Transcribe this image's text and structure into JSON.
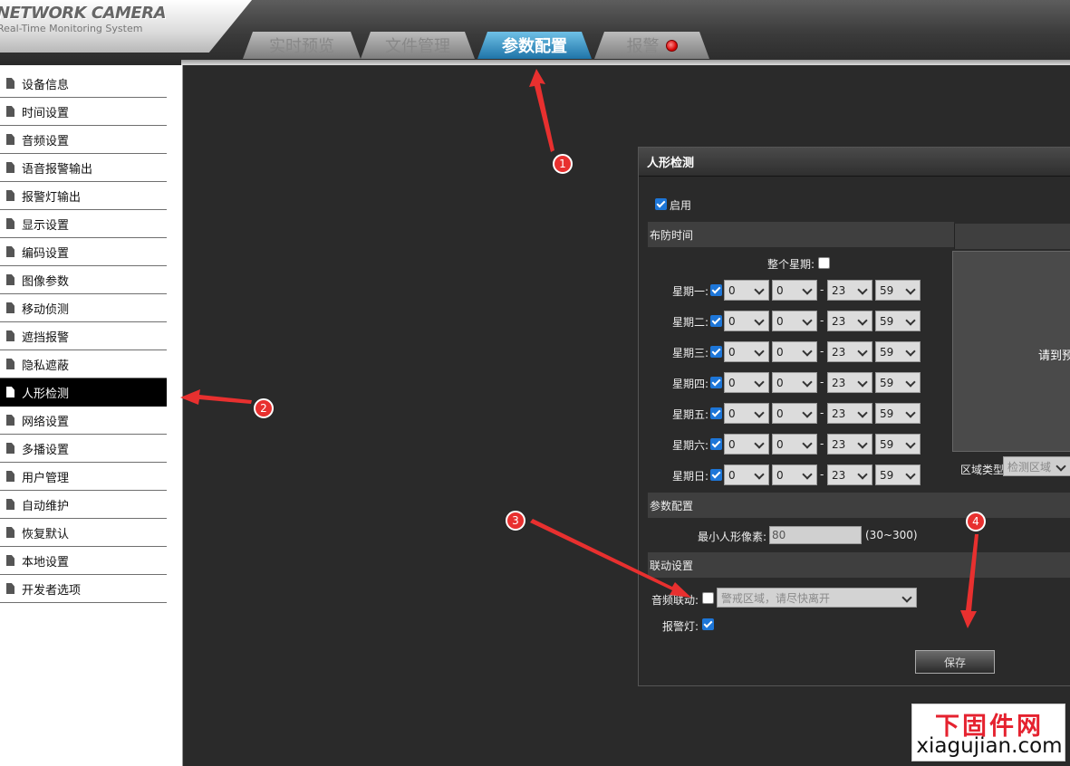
{
  "header": {
    "brand_title": "NETWORK CAMERA",
    "brand_subtitle": "Real-Time Monitoring System",
    "tabs": [
      {
        "label": "实时预览"
      },
      {
        "label": "文件管理"
      },
      {
        "label": "参数配置"
      },
      {
        "label": "报警"
      }
    ],
    "active_tab": "参数配置"
  },
  "sidebar": {
    "items": [
      {
        "label": "设备信息"
      },
      {
        "label": "时间设置"
      },
      {
        "label": "音频设置"
      },
      {
        "label": "语音报警输出"
      },
      {
        "label": "报警灯输出"
      },
      {
        "label": "显示设置"
      },
      {
        "label": "编码设置"
      },
      {
        "label": "图像参数"
      },
      {
        "label": "移动侦测"
      },
      {
        "label": "遮挡报警"
      },
      {
        "label": "隐私遮蔽"
      },
      {
        "label": "人形检测"
      },
      {
        "label": "网络设置"
      },
      {
        "label": "多播设置"
      },
      {
        "label": "用户管理"
      },
      {
        "label": "自动维护"
      },
      {
        "label": "恢复默认"
      },
      {
        "label": "本地设置"
      },
      {
        "label": "开发者选项"
      }
    ],
    "active_item": "人形检测"
  },
  "panel": {
    "title": "人形检测",
    "enable": {
      "label": "启用",
      "checked": true
    },
    "schedule": {
      "section_label": "布防时间",
      "whole_week_label": "整个星期:",
      "whole_week_checked": false,
      "days": [
        {
          "label": "星期一:",
          "checked": true,
          "start_hour": "0",
          "start_min": "0",
          "end_hour": "23",
          "end_min": "59"
        },
        {
          "label": "星期二:",
          "checked": true,
          "start_hour": "0",
          "start_min": "0",
          "end_hour": "23",
          "end_min": "59"
        },
        {
          "label": "星期三:",
          "checked": true,
          "start_hour": "0",
          "start_min": "0",
          "end_hour": "23",
          "end_min": "59"
        },
        {
          "label": "星期四:",
          "checked": true,
          "start_hour": "0",
          "start_min": "0",
          "end_hour": "23",
          "end_min": "59"
        },
        {
          "label": "星期五:",
          "checked": true,
          "start_hour": "0",
          "start_min": "0",
          "end_hour": "23",
          "end_min": "59"
        },
        {
          "label": "星期六:",
          "checked": true,
          "start_hour": "0",
          "start_min": "0",
          "end_hour": "23",
          "end_min": "59"
        },
        {
          "label": "星期日:",
          "checked": true,
          "start_hour": "0",
          "start_min": "0",
          "end_hour": "23",
          "end_min": "59"
        }
      ],
      "separator": "-"
    },
    "preview": {
      "hint": "请到预",
      "region_type_label": "区域类型",
      "region_type_value": "检测区域"
    },
    "params": {
      "section_label": "参数配置",
      "min_pixel_label": "最小人形像素:",
      "min_pixel_value": "80",
      "min_pixel_range": "(30~300)"
    },
    "linkage": {
      "section_label": "联动设置",
      "audio_label": "音频联动:",
      "audio_checked": false,
      "audio_value": "警戒区域，请尽快离开",
      "light_label": "报警灯:",
      "light_checked": true
    },
    "save_label": "保存"
  },
  "annotations": {
    "markers": [
      "1",
      "2",
      "3",
      "4"
    ],
    "color": "#e8302f"
  },
  "watermark": {
    "cn": "下固件网",
    "en": "xiagujian.com"
  }
}
